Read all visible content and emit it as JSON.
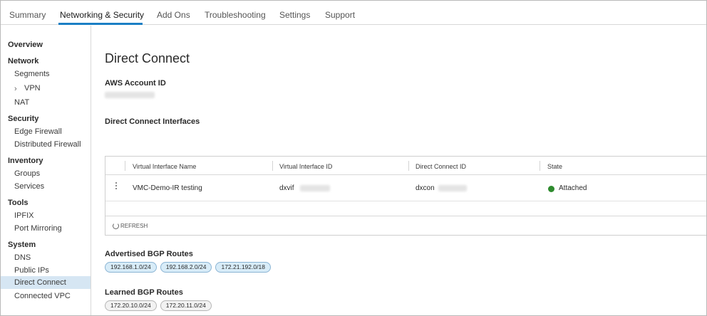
{
  "tabs": [
    {
      "label": "Summary"
    },
    {
      "label": "Networking & Security"
    },
    {
      "label": "Add Ons"
    },
    {
      "label": "Troubleshooting"
    },
    {
      "label": "Settings"
    },
    {
      "label": "Support"
    }
  ],
  "sidebar": {
    "overview": "Overview",
    "network": "Network",
    "segments": "Segments",
    "vpn": "VPN",
    "nat": "NAT",
    "security": "Security",
    "edge_firewall": "Edge Firewall",
    "distributed_firewall": "Distributed Firewall",
    "inventory": "Inventory",
    "groups": "Groups",
    "services": "Services",
    "tools": "Tools",
    "ipfix": "IPFIX",
    "port_mirroring": "Port Mirroring",
    "system": "System",
    "dns": "DNS",
    "public_ips": "Public IPs",
    "direct_connect": "Direct Connect",
    "connected_vpc": "Connected VPC"
  },
  "main": {
    "title": "Direct Connect",
    "aws_account_label": "AWS Account ID",
    "interfaces_label": "Direct Connect Interfaces",
    "table": {
      "headers": [
        "Virtual Interface Name",
        "Virtual Interface ID",
        "Direct Connect ID",
        "State"
      ],
      "row": {
        "name": "VMC-Demo-IR testing",
        "vif_id": "dxvif",
        "dx_id": "dxcon",
        "state": "Attached"
      },
      "refresh": "REFRESH"
    },
    "advertised_label": "Advertised BGP Routes",
    "advertised_routes": [
      "192.168.1.0/24",
      "192.168.2.0/24",
      "172.21.192.0/18"
    ],
    "learned_label": "Learned BGP Routes",
    "learned_routes": [
      "172.20.10.0/24",
      "172.20.11.0/24"
    ]
  },
  "colors": {
    "accent": "#1b7fc4",
    "active_nav_bg": "#d6e6f3",
    "attached_green": "#2e8b2e"
  }
}
